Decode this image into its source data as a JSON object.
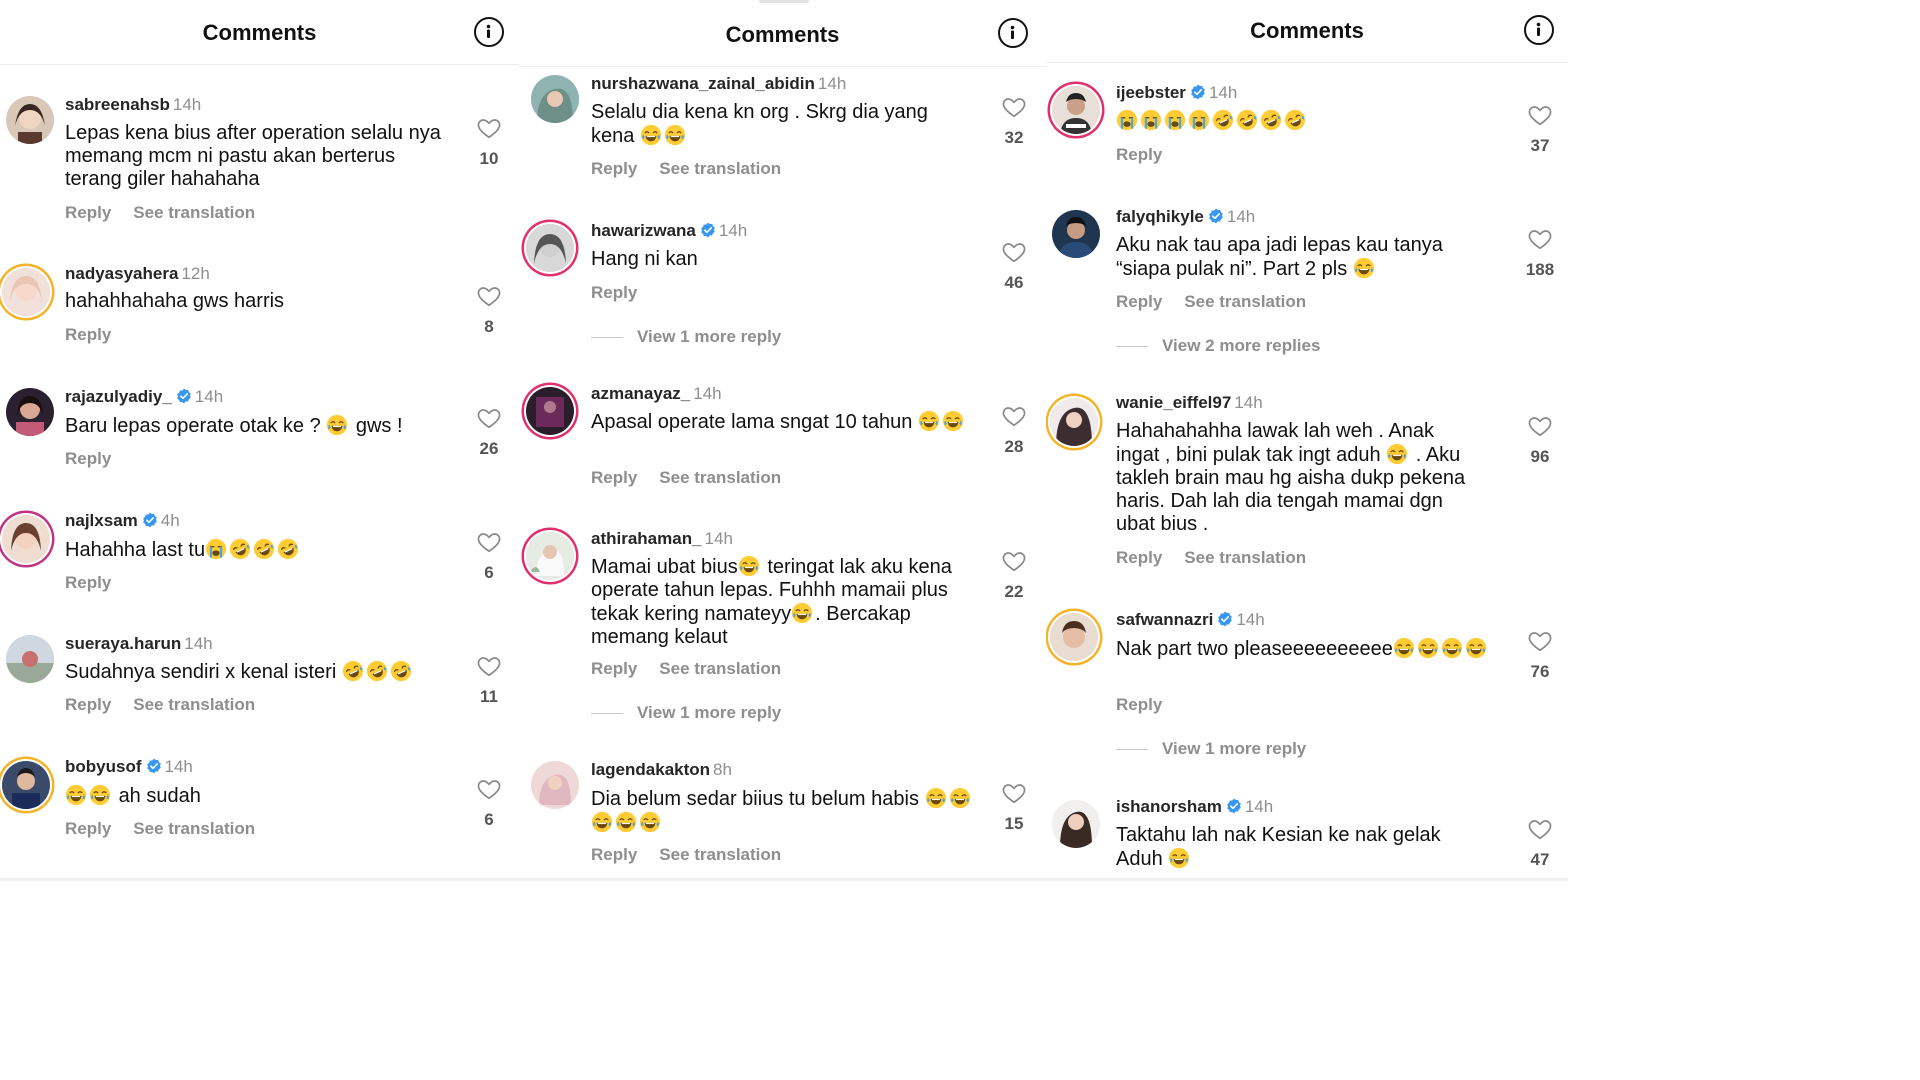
{
  "screens": [
    {
      "title": "Comments",
      "comments": [
        {
          "username": "sabreenahsb",
          "time": "14h",
          "verified": false,
          "text": "Lepas kena bius after operation selalu nya memang mcm ni pastu akan berterus terang giler hahahaha",
          "likes": "10",
          "reply": "Reply",
          "translate": "See translation"
        },
        {
          "username": "nadyasyahera",
          "time": "12h",
          "verified": false,
          "text": "hahahhahaha gws harris",
          "likes": "8",
          "reply": "Reply"
        },
        {
          "username": "rajazulyadiy_",
          "time": "14h",
          "verified": true,
          "text": "Baru lepas operate otak ke ?",
          "text_after": "gws !",
          "likes": "26",
          "reply": "Reply"
        },
        {
          "username": "najlxsam",
          "time": "4h",
          "verified": true,
          "text": "Hahahha last tu",
          "likes": "6",
          "reply": "Reply"
        },
        {
          "username": "sueraya.harun",
          "time": "14h",
          "verified": false,
          "text": "Sudahnya sendiri x kenal isteri",
          "likes": "11",
          "reply": "Reply",
          "translate": "See translation"
        },
        {
          "username": "bobyusof",
          "time": "14h",
          "verified": true,
          "text": "ah sudah",
          "likes": "6",
          "reply": "Reply",
          "translate": "See translation"
        }
      ]
    },
    {
      "title": "Comments",
      "comments": [
        {
          "username": "nurshazwana_zainal_abidin",
          "time": "14h",
          "verified": false,
          "text": "Selalu dia kena kn org . Skrg dia yang kena",
          "likes": "32",
          "reply": "Reply",
          "translate": "See translation"
        },
        {
          "username": "hawarizwana",
          "time": "14h",
          "verified": true,
          "text": "Hang ni kan",
          "likes": "46",
          "reply": "Reply",
          "more": "View 1 more reply"
        },
        {
          "username": "azmanayaz_",
          "time": "14h",
          "verified": false,
          "text": "Apasal operate lama sngat 10 tahun",
          "likes": "28",
          "reply": "Reply",
          "translate": "See translation"
        },
        {
          "username": "athirahaman_",
          "time": "14h",
          "verified": false,
          "text_l1": "Mamai ubat bius",
          "text_l1b": "teringat lak aku kena",
          "text_l2": "operate tahun lepas. Fuhhh mamaii plus",
          "text_l3": "tekak kering namateyy",
          "text_l3b": ". Bercakap",
          "text_l4": "memang kelaut",
          "likes": "22",
          "reply": "Reply",
          "translate": "See translation",
          "more": "View 1 more reply"
        },
        {
          "username": "lagendakakton",
          "time": "8h",
          "verified": false,
          "text": "Dia belum sedar biius tu belum habis",
          "likes": "15",
          "reply": "Reply",
          "translate": "See translation"
        }
      ]
    },
    {
      "title": "Comments",
      "comments": [
        {
          "username": "ijeebster",
          "time": "14h",
          "verified": true,
          "text": "",
          "likes": "37",
          "reply": "Reply"
        },
        {
          "username": "falyqhikyle",
          "time": "14h",
          "verified": true,
          "text_l1": "Aku nak tau apa jadi lepas kau tanya",
          "text_l2": "“siapa pulak ni”. Part 2 pls",
          "likes": "188",
          "reply": "Reply",
          "translate": "See translation",
          "more": "View 2 more replies"
        },
        {
          "username": "wanie_eiffel97",
          "time": "14h",
          "verified": false,
          "text_l1": "Hahahahahha lawak lah weh . Anak",
          "text_l2": "ingat , bini pulak tak ingt aduh",
          "text_l2b": ". Aku",
          "text_l3": "takleh brain mau hg aisha dukp pekena",
          "text_l4": "haris. Dah lah dia tengah mamai dgn",
          "text_l5": "ubat bius .",
          "likes": "96",
          "reply": "Reply",
          "translate": "See translation"
        },
        {
          "username": "safwannazri",
          "time": "14h",
          "verified": true,
          "text": "Nak part two pleaseeeeeeeeee",
          "likes": "76",
          "reply": "Reply",
          "more": "View 1 more reply"
        },
        {
          "username": "ishanorsham",
          "time": "14h",
          "verified": true,
          "text_l1": "Taktahu lah nak Kesian ke nak gelak",
          "text_l2": "Aduh",
          "likes": "47"
        }
      ]
    }
  ],
  "colors": {
    "verified": "#3897f0",
    "ring_pink": "#e1306c",
    "ring_yellow": "#f5b32a",
    "muted": "#8e8e8e"
  },
  "icons": [
    "info-icon",
    "heart-icon",
    "verified-badge-icon",
    "laughing-emoji",
    "rofl-emoji"
  ]
}
